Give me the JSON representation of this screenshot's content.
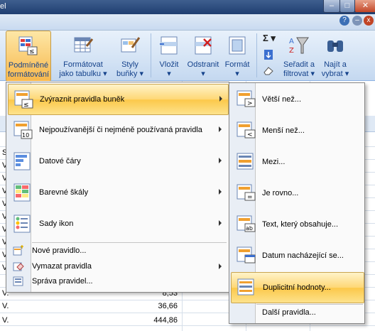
{
  "window": {
    "title_fragment": "el",
    "minimize_symbol": "–",
    "maximize_symbol": "□",
    "close_symbol": "✕"
  },
  "ribbon": {
    "buttons": [
      {
        "label1": "Podmíněné",
        "label2": "formátování ▾"
      },
      {
        "label1": "Formátovat",
        "label2": "jako tabulku ▾"
      },
      {
        "label1": "Styly",
        "label2": "buňky ▾"
      },
      {
        "label1": "Vložit",
        "label2": "▾"
      },
      {
        "label1": "Odstranit",
        "label2": "▾"
      },
      {
        "label1": "Formát",
        "label2": "▾"
      },
      {
        "label1": "Seřadit a",
        "label2": "filtrovat ▾"
      },
      {
        "label1": "Najít a",
        "label2": "vybrat ▾"
      }
    ],
    "sigma_symbol": "Σ ▾"
  },
  "menu": {
    "items": [
      {
        "label": "Zvýraznit pravidla buněk"
      },
      {
        "label": "Nejpoužívanější či nejméně používaná pravidla"
      },
      {
        "label": "Datové čáry"
      },
      {
        "label": "Barevné škály"
      },
      {
        "label": "Sady ikon"
      }
    ],
    "small_items": [
      {
        "label": "Nové pravidlo..."
      },
      {
        "label": "Vymazat pravidla"
      },
      {
        "label": "Správa pravidel..."
      }
    ]
  },
  "submenu": {
    "items": [
      {
        "label": "Větší než..."
      },
      {
        "label": "Menší než..."
      },
      {
        "label": "Mezi..."
      },
      {
        "label": "Je rovno..."
      },
      {
        "label": "Text, který obsahuje..."
      },
      {
        "label": "Datum nacházející se..."
      },
      {
        "label": "Duplicitní hodnoty..."
      }
    ],
    "more_label": "Další pravidla..."
  },
  "sheet": {
    "col_a": [
      "S",
      "V.",
      "V.",
      "V.",
      "V.",
      "V.",
      "V.",
      "V.",
      "V.",
      "V.",
      "V.",
      "V.",
      "V."
    ],
    "numbers": [
      "8,53",
      "36,66",
      "444,86"
    ]
  }
}
